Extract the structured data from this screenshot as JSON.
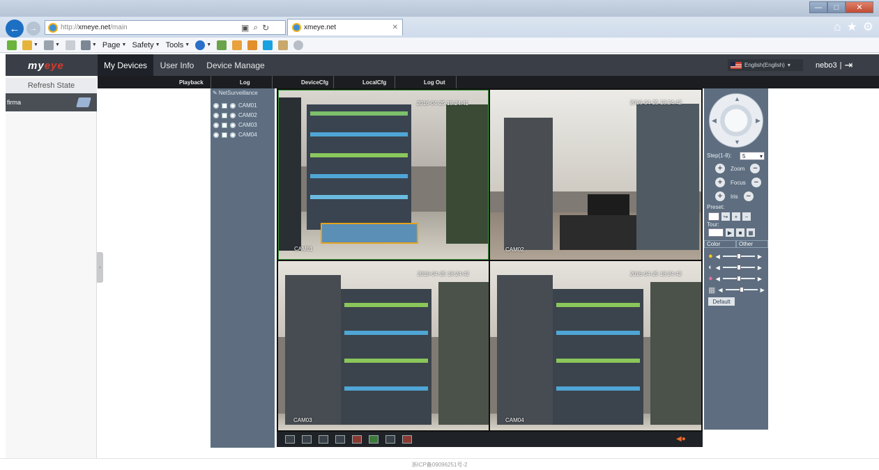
{
  "browser": {
    "address_prefix": "http://",
    "address_host": "xmeye.net",
    "address_path": "/main",
    "tab_title": "xmeye.net",
    "menu": {
      "page": "Page",
      "safety": "Safety",
      "tools": "Tools"
    },
    "window_controls": {
      "minimize": "—",
      "maximize": "□",
      "close": "✕"
    }
  },
  "app": {
    "logo_main": "my",
    "logo_accent": "eye",
    "nav": {
      "my_devices": "My Devices",
      "user_info": "User Info",
      "device_manage": "Device Manage"
    },
    "language": "English(English)",
    "username": "nebo3",
    "user_sep": "|",
    "refresh": "Refresh State",
    "device_name": "firma",
    "submenu": {
      "playback": "Playback",
      "log": "Log",
      "devicecfg": "DeviceCfg",
      "localcfg": "LocalCfg",
      "logout": "Log Out"
    },
    "tree_title": "NetSurveillance",
    "channels": [
      "CAM01",
      "CAM02",
      "CAM03",
      "CAM04"
    ],
    "videos": [
      {
        "label": "CAM01",
        "timestamp": "2016-04-25 18:24:41"
      },
      {
        "label": "CAM02",
        "timestamp": "2016-04-25 18:24:42"
      },
      {
        "label": "CAM03",
        "timestamp": "2016-04-25 18:24:42"
      },
      {
        "label": "CAM04",
        "timestamp": "2016-04-25 18:24:42"
      }
    ],
    "ptz": {
      "step_label": "Step(1-8):",
      "step_value": "5",
      "zoom": "Zoom",
      "focus": "Focus",
      "iris": "Iris",
      "preset": "Preset:",
      "tour": "Tour:",
      "tab_color": "Color",
      "tab_other": "Other",
      "default": "Default",
      "sliders": [
        0.5,
        0.5,
        0.5,
        0.5
      ]
    },
    "footer": "浙ICP备09096251号-2"
  },
  "colors": {
    "header": "#3a3f47",
    "panel": "#5e6e80",
    "accent": "#d93a2b"
  }
}
